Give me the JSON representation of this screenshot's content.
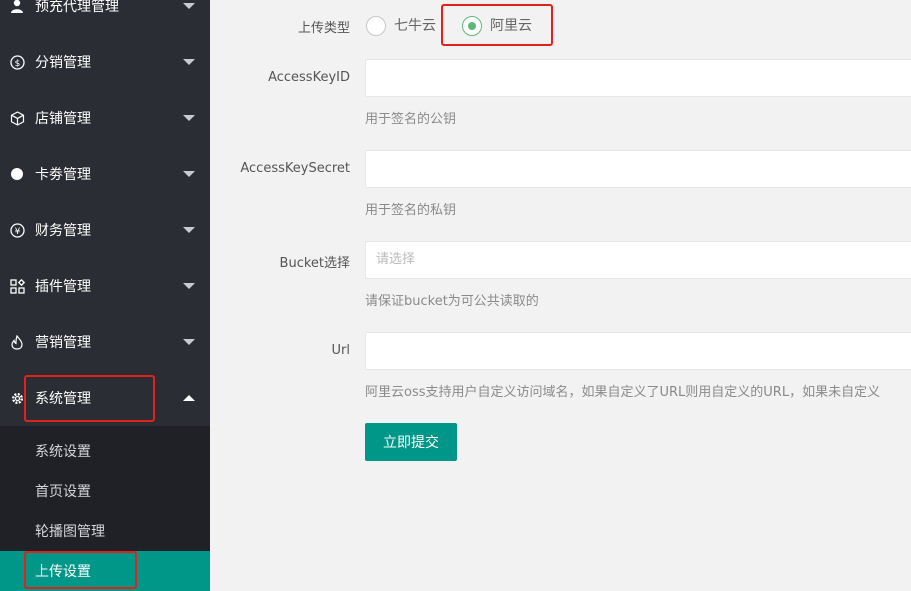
{
  "sidebar": {
    "items": [
      {
        "label": "预充代理管理",
        "icon": "user-icon"
      },
      {
        "label": "分销管理",
        "icon": "dollar-circle-icon"
      },
      {
        "label": "店铺管理",
        "icon": "cube-icon"
      },
      {
        "label": "卡劵管理",
        "icon": "dot-icon"
      },
      {
        "label": "财务管理",
        "icon": "yen-circle-icon"
      },
      {
        "label": "插件管理",
        "icon": "plugin-icon"
      },
      {
        "label": "营销管理",
        "icon": "fire-icon"
      },
      {
        "label": "系统管理",
        "icon": "gear-icon"
      }
    ],
    "subitems": [
      {
        "label": "系统设置"
      },
      {
        "label": "首页设置"
      },
      {
        "label": "轮播图管理"
      },
      {
        "label": "上传设置"
      }
    ]
  },
  "form": {
    "upload_type_label": "上传类型",
    "options": [
      "七牛云",
      "阿里云"
    ],
    "selected": "阿里云",
    "access_key_id_label": "AccessKeyID",
    "access_key_id_value": "",
    "access_key_id_hint": "用于签名的公钥",
    "access_key_secret_label": "AccessKeySecret",
    "access_key_secret_value": "",
    "access_key_secret_hint": "用于签名的私钥",
    "bucket_label": "Bucket选择",
    "bucket_placeholder": "请选择",
    "bucket_hint": "请保证bucket为可公共读取的",
    "url_label": "Url",
    "url_value": "",
    "url_hint": "阿里云oss支持用户自定义访问域名，如果自定义了URL则用自定义的URL，如果未自定义",
    "submit_label": "立即提交"
  },
  "colors": {
    "sidebar": "#2a2d34",
    "submenu": "#1f2126",
    "accent": "#009688",
    "radio": "#5fb878",
    "highlight": "#e0221b"
  }
}
